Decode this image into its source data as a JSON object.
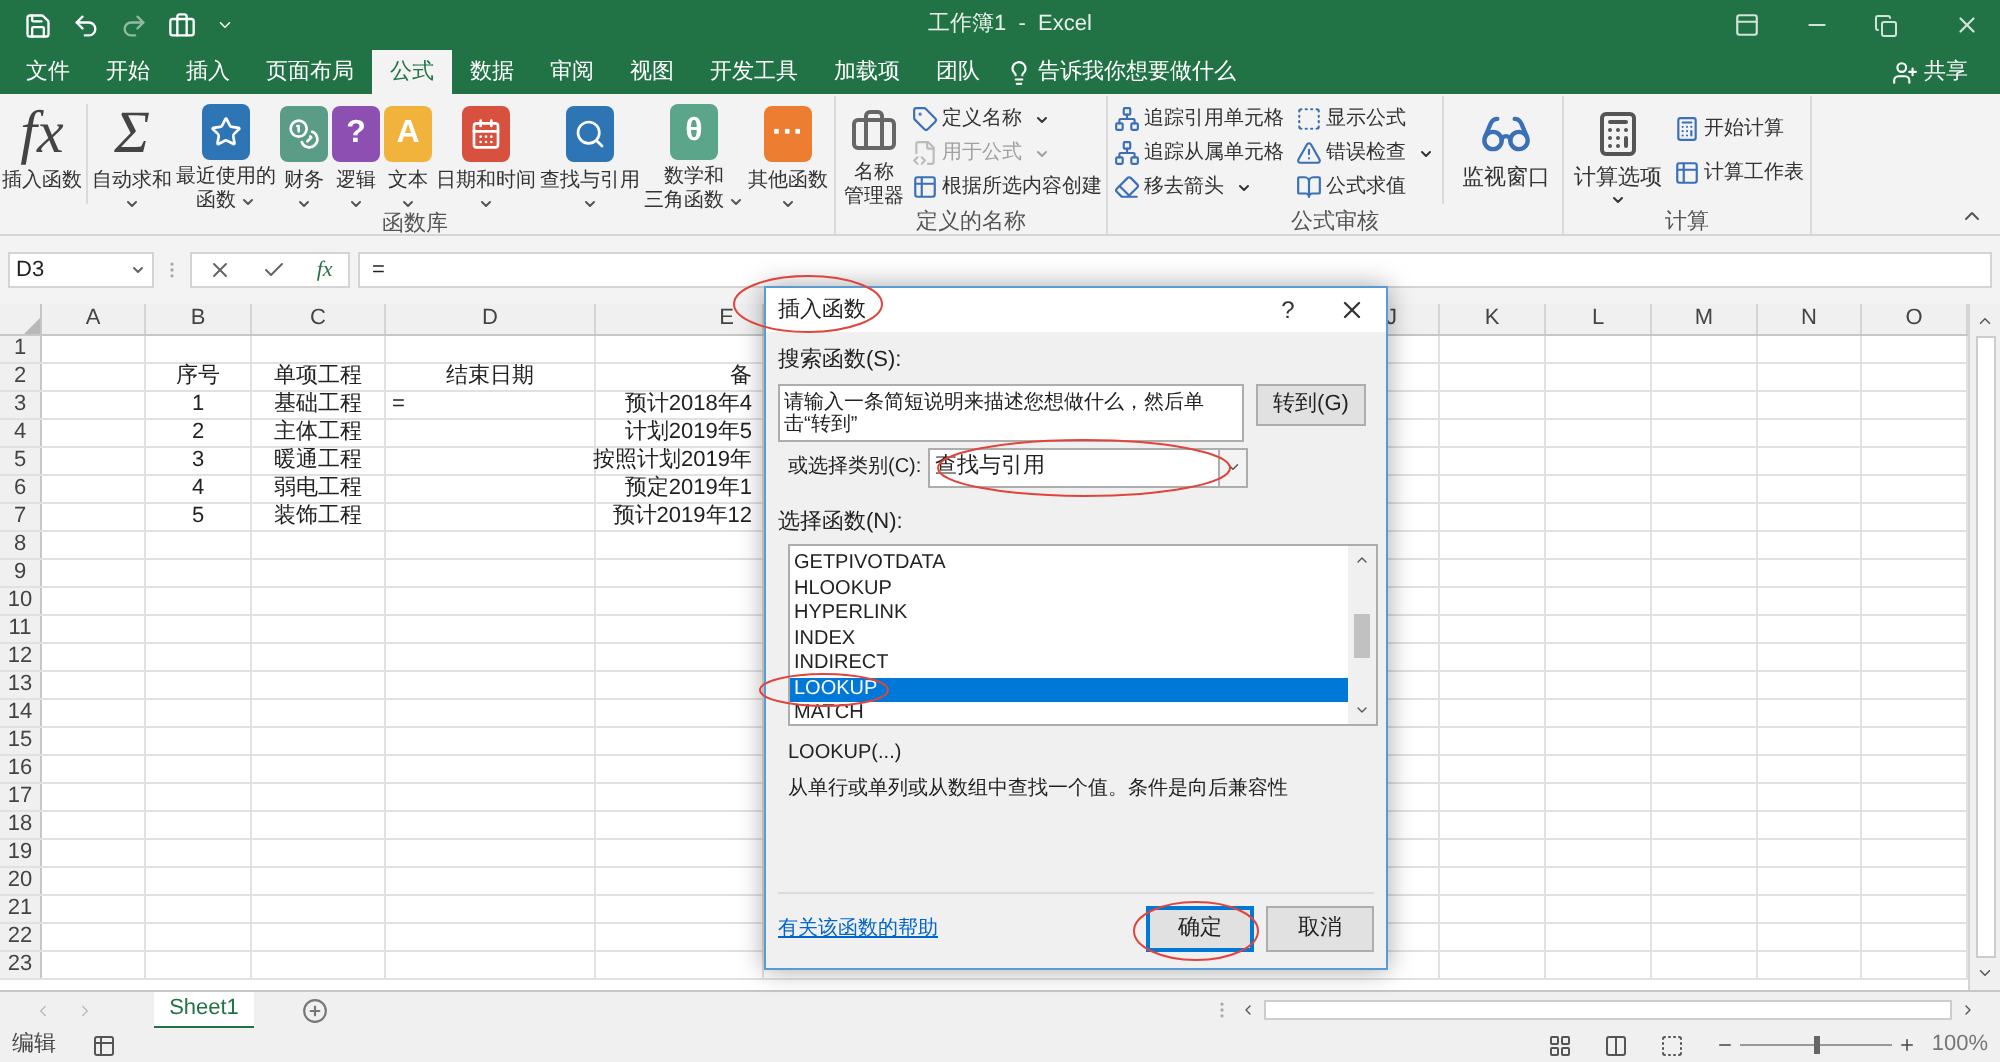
{
  "window": {
    "title": "工作簿1  -  Excel"
  },
  "menu_tabs": [
    {
      "label": "文件",
      "selected": false
    },
    {
      "label": "开始",
      "selected": false
    },
    {
      "label": "插入",
      "selected": false
    },
    {
      "label": "页面布局",
      "selected": false
    },
    {
      "label": "公式",
      "selected": true
    },
    {
      "label": "数据",
      "selected": false
    },
    {
      "label": "审阅",
      "selected": false
    },
    {
      "label": "视图",
      "selected": false
    },
    {
      "label": "开发工具",
      "selected": false
    },
    {
      "label": "加载项",
      "selected": false
    },
    {
      "label": "团队",
      "selected": false
    }
  ],
  "tell_me": {
    "placeholder": "告诉我你想要做什么"
  },
  "share": "共享",
  "ribbon": {
    "function_library": {
      "label": "函数库",
      "buttons": [
        {
          "label": "插入函数",
          "kind": "glyph",
          "glyph": "fx",
          "dropdown": false
        },
        {
          "label": "自动求和",
          "kind": "glyph",
          "glyph": "Σ",
          "dropdown": true
        },
        {
          "label": [
            "最近使用的",
            "函数"
          ],
          "kind": "star",
          "color": "#2e75b6",
          "dropdown": true
        },
        {
          "label": "财务",
          "kind": "coins",
          "color": "#5b9c86",
          "dropdown": true
        },
        {
          "label": "逻辑",
          "kind": "book",
          "glyph": "?",
          "color": "#8e4fb3",
          "dropdown": true
        },
        {
          "label": "文本",
          "kind": "book",
          "glyph": "A",
          "color": "#f2b33d",
          "dropdown": true
        },
        {
          "label": "日期和时间",
          "kind": "calendar",
          "color": "#d8503e",
          "dropdown": true
        },
        {
          "label": "查找与引用",
          "kind": "search",
          "color": "#2e75b6",
          "dropdown": true
        },
        {
          "label": [
            "数学和",
            "三角函数"
          ],
          "kind": "book",
          "glyph": "θ",
          "color": "#5ba58b",
          "dropdown": true
        },
        {
          "label": "其他函数",
          "kind": "book",
          "glyph": "···",
          "color": "#ed7d31",
          "dropdown": true
        }
      ]
    },
    "defined_names": {
      "label": "定义的名称",
      "large": [
        "名称",
        "管理器"
      ],
      "items": [
        {
          "label": "定义名称",
          "dropdown": true,
          "disabled": false
        },
        {
          "label": "用于公式",
          "dropdown": true,
          "disabled": true
        },
        {
          "label": "根据所选内容创建",
          "dropdown": false,
          "disabled": false
        }
      ]
    },
    "formula_auditing": {
      "label": "公式审核",
      "column_1": [
        {
          "label": "追踪引用单元格",
          "dropdown": false
        },
        {
          "label": "追踪从属单元格",
          "dropdown": false
        },
        {
          "label": "移去箭头",
          "dropdown": true
        }
      ],
      "column_2": [
        {
          "label": "显示公式",
          "dropdown": false
        },
        {
          "label": "错误检查",
          "dropdown": true
        },
        {
          "label": "公式求值",
          "dropdown": false
        }
      ],
      "large": "监视窗口"
    },
    "calculation": {
      "label": "计算",
      "large": "计算选项",
      "items": [
        "开始计算",
        "计算工作表"
      ]
    }
  },
  "formula_bar": {
    "name_box": "D3",
    "fx": "fx",
    "value": "="
  },
  "sheet": {
    "columns": [
      "A",
      "B",
      "C",
      "D",
      "E",
      "J",
      "K",
      "L",
      "M",
      "N",
      "O"
    ],
    "rows": [
      {
        "label": "1"
      },
      {
        "label": "2",
        "kind": "header",
        "cells": [
          "序号",
          "单项工程",
          "结束日期",
          "备"
        ]
      },
      {
        "label": "3",
        "kind": "data",
        "cells": [
          "1",
          "基础工程",
          "=",
          "预计2018年4"
        ]
      },
      {
        "label": "4",
        "kind": "data",
        "cells": [
          "2",
          "主体工程",
          "",
          "计划2019年5"
        ]
      },
      {
        "label": "5",
        "kind": "data",
        "cells": [
          "3",
          "暖通工程",
          "",
          "按照计划2019年"
        ]
      },
      {
        "label": "6",
        "kind": "data",
        "cells": [
          "4",
          "弱电工程",
          "",
          "预定2019年1"
        ]
      },
      {
        "label": "7",
        "kind": "data",
        "cells": [
          "5",
          "装饰工程",
          "",
          "预计2019年12"
        ]
      },
      {
        "label": "8"
      },
      {
        "label": "9"
      },
      {
        "label": "10"
      },
      {
        "label": "11"
      },
      {
        "label": "12"
      },
      {
        "label": "13"
      },
      {
        "label": "14"
      },
      {
        "label": "15"
      },
      {
        "label": "16"
      },
      {
        "label": "17"
      },
      {
        "label": "18"
      },
      {
        "label": "19"
      },
      {
        "label": "20"
      },
      {
        "label": "21"
      },
      {
        "label": "22"
      },
      {
        "label": "23"
      }
    ]
  },
  "sheet_tabs": [
    {
      "label": "Sheet1",
      "selected": true
    }
  ],
  "status_bar": {
    "mode": "编辑",
    "zoom": "100%",
    "zoom_slider": {
      "level": 0.5
    }
  },
  "dialog": {
    "title": "插入函数",
    "help": "?",
    "search_label": "搜索函数(S):",
    "search_value": "请输入一条简短说明来描述您想做什么，然后单击“转到”",
    "go_button": "转到(G)",
    "category_label": "或选择类别(C):",
    "category_value": "查找与引用",
    "list_label": "选择函数(N):",
    "functions": [
      {
        "label": "GETPIVOTDATA",
        "selected": false
      },
      {
        "label": "HLOOKUP",
        "selected": false
      },
      {
        "label": "HYPERLINK",
        "selected": false
      },
      {
        "label": "INDEX",
        "selected": false
      },
      {
        "label": "INDIRECT",
        "selected": false
      },
      {
        "label": "LOOKUP",
        "selected": true
      },
      {
        "label": "MATCH",
        "selected": false
      }
    ],
    "signature": "LOOKUP(...)",
    "description": "从单行或单列或从数组中查找一个值。条件是向后兼容性",
    "help_link": "有关该函数的帮助",
    "ok": "确定",
    "cancel": "取消"
  }
}
